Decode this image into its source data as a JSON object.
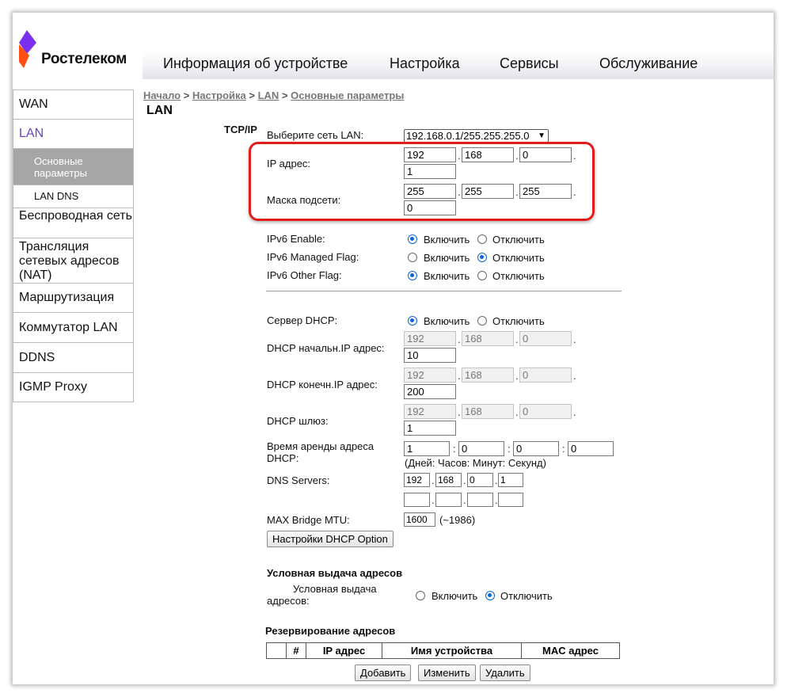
{
  "logo": {
    "text": "Ростелеком",
    "color": "#7b2ff0"
  },
  "topnav": [
    "Информация об устройстве",
    "Настройка",
    "Сервисы",
    "Обслуживание"
  ],
  "sidebar": {
    "items": [
      "WAN",
      "LAN",
      "Беспроводная сеть",
      "Трансляция сетевых адресов (NAT)",
      "Маршрутизация",
      "Коммутатор LAN",
      "DDNS",
      "IGMP Proxy"
    ],
    "sub": [
      "Основные параметры",
      "LAN DNS"
    ]
  },
  "breadcrumb": [
    "Начало",
    "Настройка",
    "LAN",
    "Основные параметры"
  ],
  "page_title": "LAN",
  "section_tcpip": "TCP/IP",
  "lan_select": {
    "label": "Выберите сеть LAN:",
    "value": "192.168.0.1/255.255.255.0"
  },
  "ip": {
    "label": "IP адрес:",
    "octets": [
      "192",
      "168",
      "0",
      "1"
    ]
  },
  "mask": {
    "label": "Маска подсети:",
    "octets": [
      "255",
      "255",
      "255",
      "0"
    ]
  },
  "ipv6_enable": {
    "label": "IPv6 Enable:",
    "on": "Включить",
    "off": "Отключить"
  },
  "ipv6_managed": {
    "label": "IPv6 Managed Flag:",
    "on": "Включить",
    "off": "Отключить"
  },
  "ipv6_other": {
    "label": "IPv6 Other Flag:",
    "on": "Включить",
    "off": "Отключить"
  },
  "dhcp_server": {
    "label": "Сервер DHCP:",
    "on": "Включить",
    "off": "Отключить"
  },
  "dhcp_start": {
    "label": "DHCP начальн.IP адрес:",
    "octets": [
      "192",
      "168",
      "0",
      "10"
    ]
  },
  "dhcp_end": {
    "label": "DHCP конечн.IP адрес:",
    "octets": [
      "192",
      "168",
      "0",
      "200"
    ]
  },
  "dhcp_gw": {
    "label": "DHCP шлюз:",
    "octets": [
      "192",
      "168",
      "0",
      "1"
    ]
  },
  "lease": {
    "label": "Время аренды адреса DHCP:",
    "values": [
      "1",
      "0",
      "0",
      "0"
    ],
    "hint": "(Дней: Часов: Минут: Секунд)"
  },
  "dns": {
    "label": "DNS Servers:",
    "row1": [
      "192",
      "168",
      "0",
      "1"
    ],
    "row2": [
      "",
      "",
      "",
      ""
    ]
  },
  "mtu": {
    "label": "MAX Bridge MTU:",
    "value": "1600",
    "hint": "(~1986)"
  },
  "dhcp_option_button": "Настройки DHCP Option",
  "cond": {
    "title": "Условная выдача адресов",
    "label": "Условная выдача адресов:",
    "on": "Включить",
    "off": "Отключить"
  },
  "reservation": {
    "title": "Резервирование адресов",
    "columns": [
      "",
      "#",
      "IP адрес",
      "Имя устройства",
      "MAC адрес"
    ]
  },
  "buttons": {
    "add": "Добавить",
    "edit": "Изменить",
    "delete": "Удалить"
  },
  "colors": {
    "accent": "#7b2ff0",
    "highlight": "#e21b1b",
    "radio": "#0a66d8"
  }
}
